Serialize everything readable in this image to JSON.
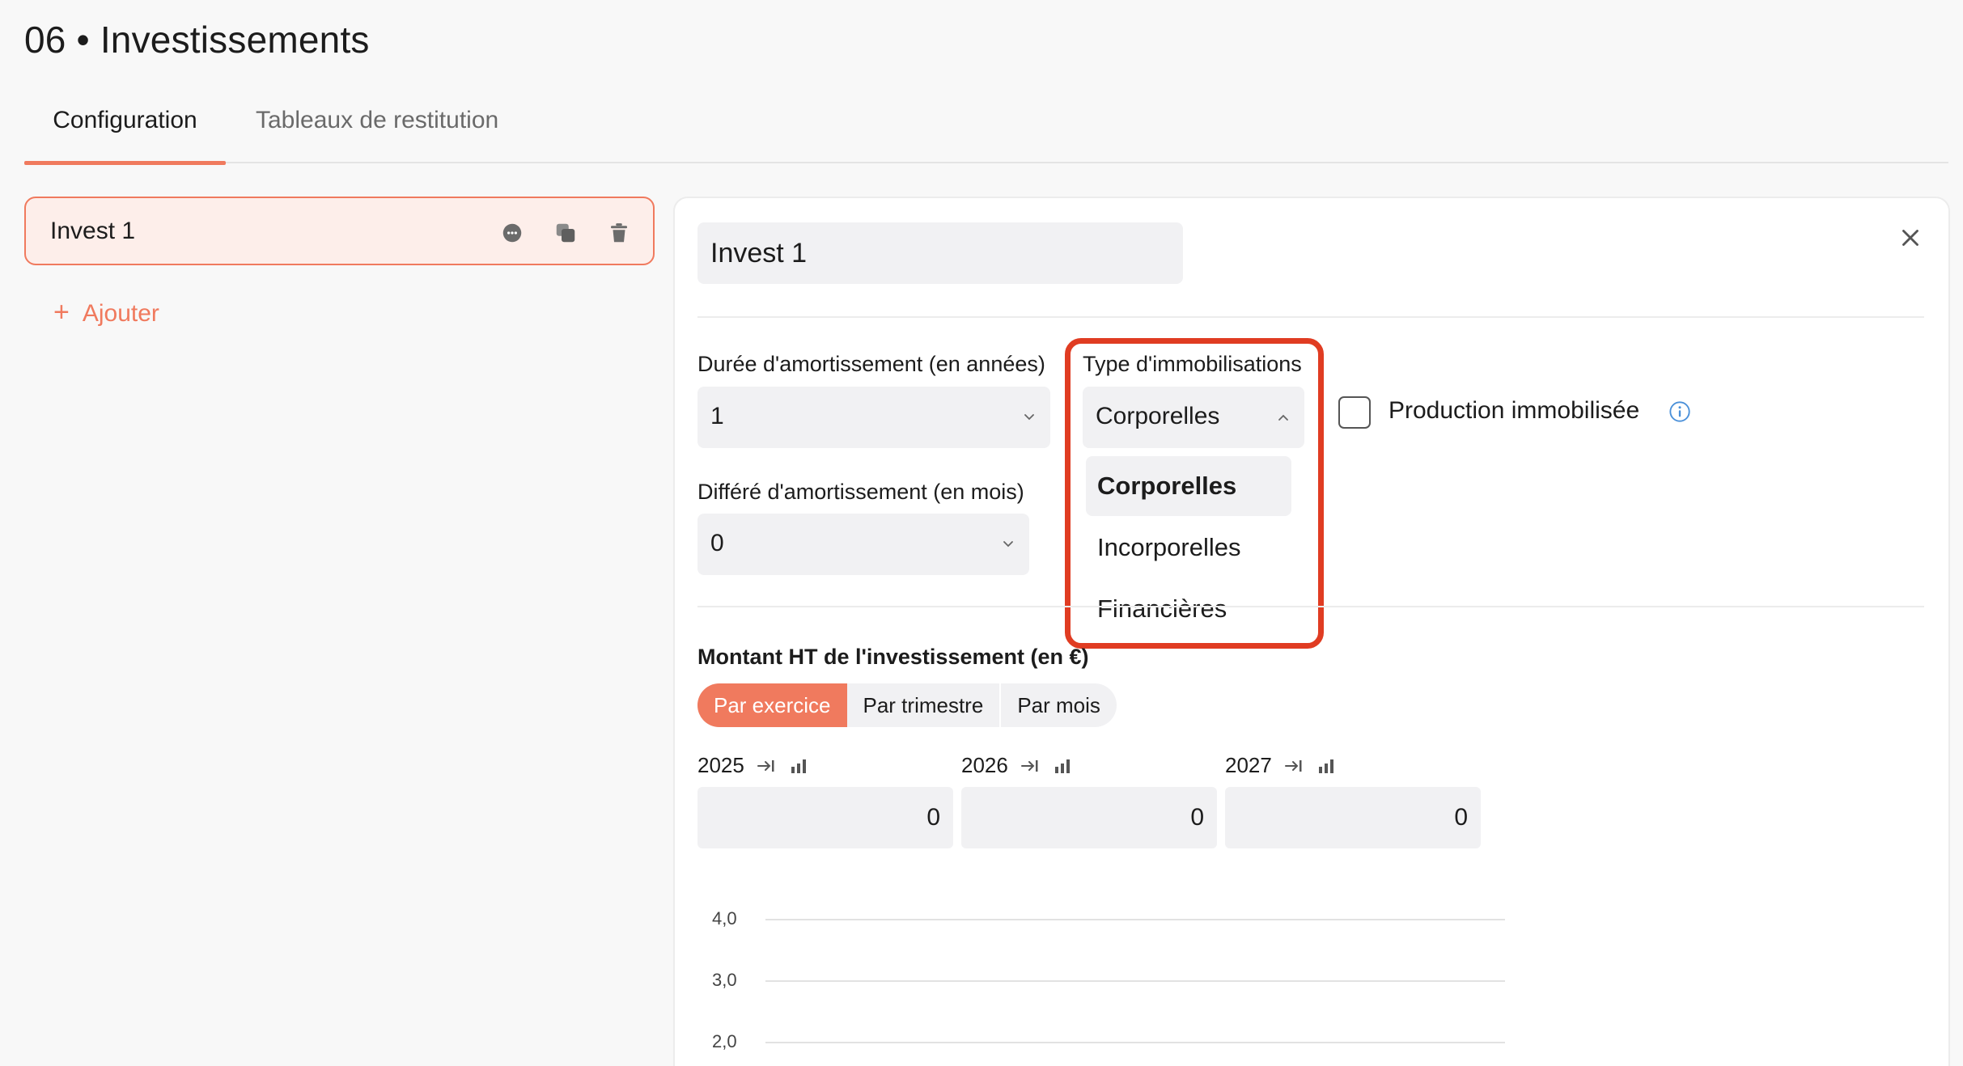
{
  "page": {
    "title": "06 • Investissements"
  },
  "tabs": [
    {
      "label": "Configuration",
      "active": true
    },
    {
      "label": "Tableaux de restitution",
      "active": false
    }
  ],
  "investments": {
    "items": [
      {
        "name": "Invest 1",
        "selected": true
      }
    ],
    "add_label": "Ajouter"
  },
  "form": {
    "name_value": "Invest 1",
    "duree": {
      "label": "Durée d'amortissement (en années)",
      "value": "1"
    },
    "differe": {
      "label": "Différé d'amortissement (en mois)",
      "value": "0"
    },
    "type": {
      "label": "Type d'immobilisations",
      "value": "Corporelles",
      "options": [
        "Corporelles",
        "Incorporelles",
        "Financières"
      ],
      "selected_index": 0
    },
    "production": {
      "label": "Production immobilisée",
      "checked": false
    },
    "montant": {
      "label": "Montant HT de l'investissement (en €)",
      "periods": [
        "Par exercice",
        "Par trimestre",
        "Par mois"
      ],
      "active_period": "Par exercice",
      "years": [
        {
          "year": "2025",
          "value": "0"
        },
        {
          "year": "2026",
          "value": "0"
        },
        {
          "year": "2027",
          "value": "0"
        }
      ]
    }
  },
  "chart": {
    "y_ticks": [
      "4,0",
      "3,0",
      "2,0"
    ]
  },
  "colors": {
    "accent": "#f07a5e",
    "highlight": "#e03c22",
    "field_bg": "#f1f1f3"
  }
}
